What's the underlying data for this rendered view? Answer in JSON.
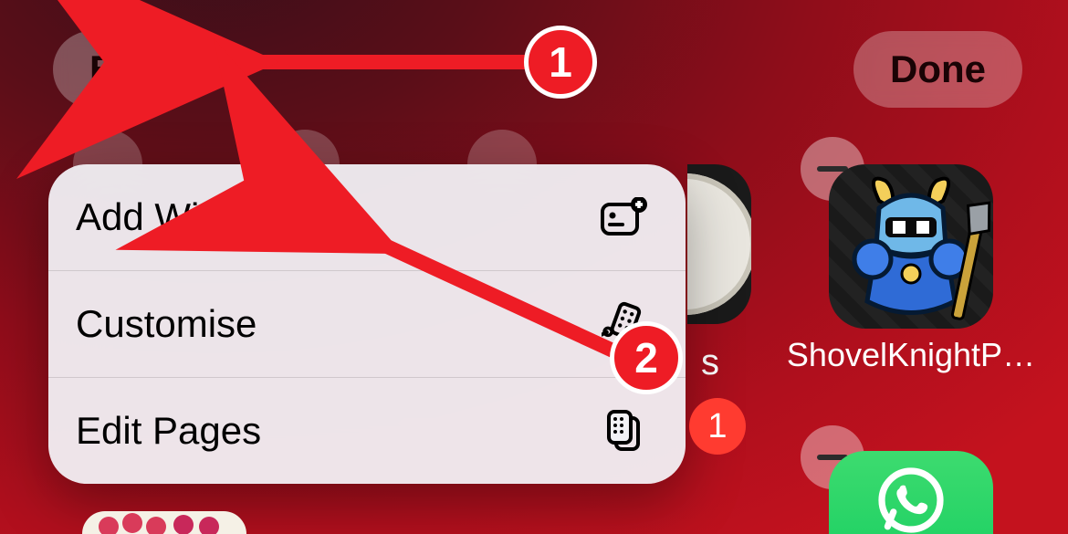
{
  "colors": {
    "annotation": "#ee1c25",
    "badge_red": "#ff3b30",
    "whatsapp": "#25d366"
  },
  "buttons": {
    "edit_label": "Edit",
    "done_label": "Done"
  },
  "context_menu": {
    "items": [
      {
        "label": "Add Widget",
        "icon": "widget-add"
      },
      {
        "label": "Customise",
        "icon": "customise"
      },
      {
        "label": "Edit Pages",
        "icon": "pages"
      }
    ]
  },
  "apps": {
    "shovel_knight": {
      "label": "ShovelKnightP…",
      "delete_visible": true
    },
    "whatsapp": {
      "delete_visible": true
    },
    "badge_count": "1"
  },
  "annotations": {
    "step1": "1",
    "step2": "2"
  },
  "peek_label": "s"
}
